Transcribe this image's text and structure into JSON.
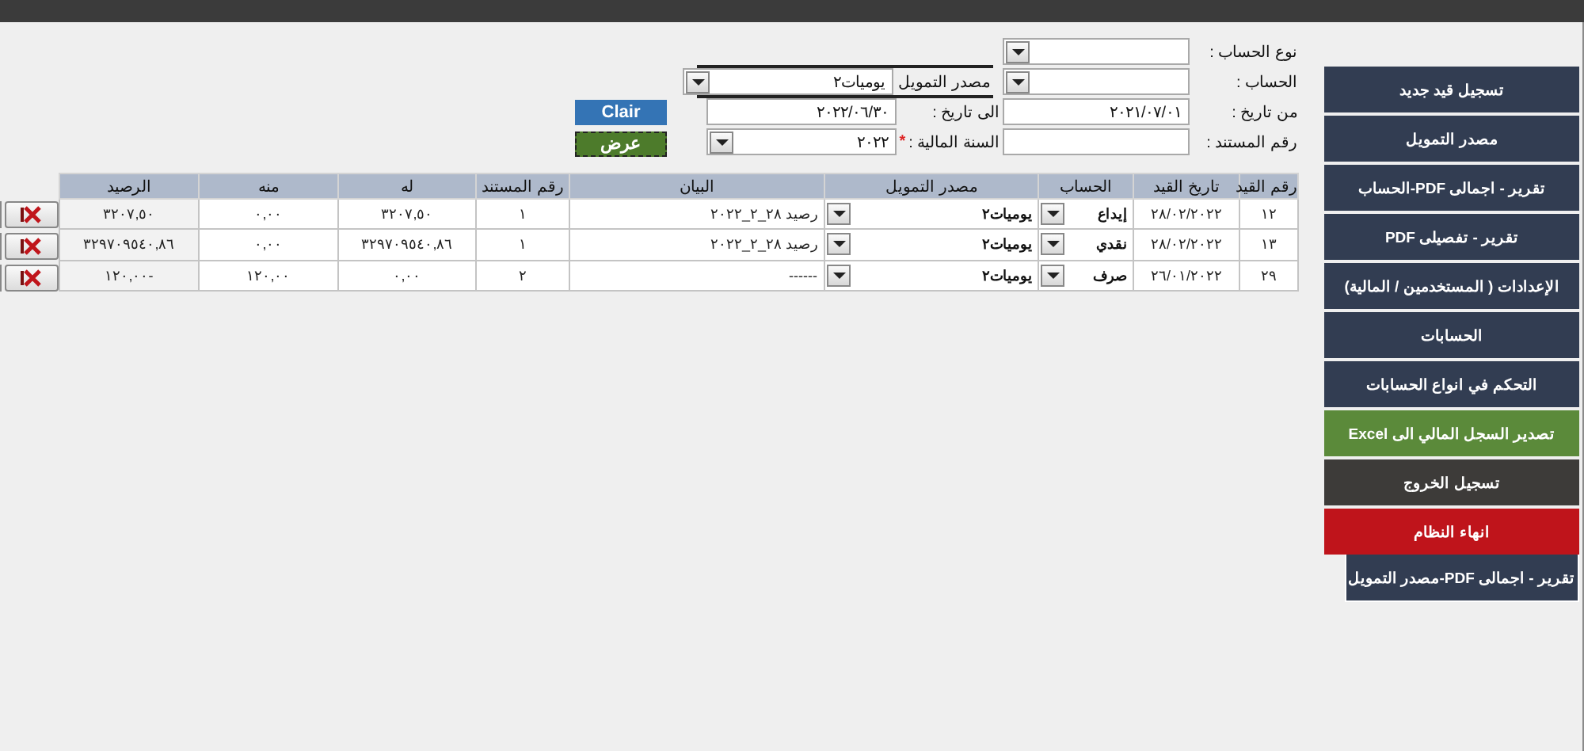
{
  "filters": [
    {
      "kind": "select",
      "label": "نوع الحساب :"
    },
    {
      "kind": "select",
      "label": "الحساب :",
      "extra": {
        "kind": "select",
        "label": "مصدر التمويل",
        "value": "يوميات٢"
      }
    },
    {
      "kind": "input",
      "label": "من تاريخ :",
      "value": "٢٠٢١/٠٧/٠١",
      "extra": {
        "kind": "input",
        "label": "الى تاريخ :",
        "value": "٢٠٢٢/٠٦/٣٠"
      },
      "button": {
        "label": "Clair",
        "kind": "clear"
      }
    },
    {
      "kind": "input",
      "label": "رقم المستند :",
      "extra": {
        "kind": "select",
        "label": "السنة المالية :",
        "marker": "*",
        "value": "٢٠٢٢"
      },
      "button": {
        "label": "عرض",
        "kind": "show"
      }
    }
  ],
  "table": {
    "columns": [
      "رقم القيد",
      "تاريخ القيد",
      "الحساب",
      "مصدر التمويل",
      "البيان",
      "رقم المستند",
      "له",
      "منه",
      "الرصيد"
    ],
    "rows": [
      {
        "entry_no": "١٢",
        "date": "٢٨/٠٢/٢٠٢٢",
        "account": "إيداع",
        "source": "يوميات٢",
        "description": "رصيد ٢٨_٢_٢٠٢٢",
        "doc_no": "١",
        "credit": "٣٢٠٧,٥٠",
        "debit": "٠,٠٠",
        "balance": "٣٢٠٧,٥٠"
      },
      {
        "entry_no": "١٣",
        "date": "٢٨/٠٢/٢٠٢٢",
        "account": "نقدي",
        "source": "يوميات٢",
        "description": "رصيد ٢٨_٢_٢٠٢٢",
        "doc_no": "١",
        "credit": "٣٢٩٧٠٩٥٤٠,٨٦",
        "debit": "٠,٠٠",
        "balance": "٣٢٩٧٠٩٥٤٠,٨٦"
      },
      {
        "entry_no": "٢٩",
        "date": "٢٦/٠١/٢٠٢٢",
        "account": "صرف",
        "source": "يوميات٢",
        "description": "------",
        "doc_no": "٢",
        "credit": "٠,٠٠",
        "debit": "١٢٠,٠٠",
        "balance": "-١٢٠,٠٠"
      }
    ]
  },
  "sidebar": {
    "buttons": [
      {
        "label": "تسجيل قيد جديد",
        "color": "#323d52"
      },
      {
        "label": "مصدر التمويل",
        "color": "#323d52"
      },
      {
        "label": "تقرير - اجمالى PDF-الحساب",
        "color": "#323d52"
      },
      {
        "label": "تقرير - تفصيلى PDF",
        "color": "#323d52"
      },
      {
        "label": "الإعدادات ( المستخدمين / المالية)",
        "color": "#323d52"
      },
      {
        "label": "الحسابات",
        "color": "#323d52"
      },
      {
        "label": "التحكم في انواع الحسابات",
        "color": "#323d52"
      },
      {
        "label": "تصدير السجل المالي الى Excel",
        "color": "#5b8a3a"
      },
      {
        "label": "تسجيل الخروج",
        "color": "#3d3b39"
      },
      {
        "label": "انهاء النظام",
        "color": "#bf141b"
      },
      {
        "label": "تقرير - اجمالى PDF-مصدر التمويل",
        "color": "#323d52",
        "kind": "raised"
      }
    ]
  }
}
